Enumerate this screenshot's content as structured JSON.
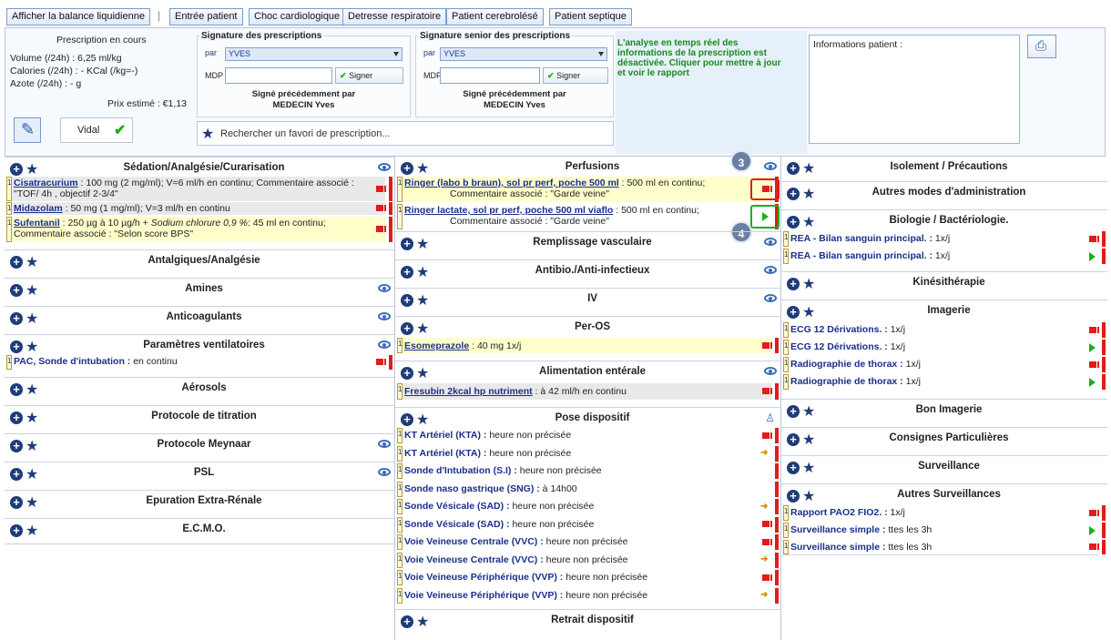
{
  "toolbar": {
    "balance": "Afficher la balance liquidienne",
    "entree": "Entrée patient",
    "choc": "Choc cardiologique",
    "detresse": "Detresse respiratoire",
    "cerebro": "Patient cerebrolésé",
    "septique": "Patient septique"
  },
  "prescription": {
    "title": "Prescription en cours",
    "volume": "Volume (/24h) : 6,25 ml/kg",
    "calories": "Calories (/24h) : - KCal (/kg=-)",
    "azote": "Azote (/24h) : - g",
    "prix": "Prix estimé : €1,13",
    "vidal": "Vidal"
  },
  "sig1": {
    "title": "Signature des prescriptions",
    "par": "par",
    "user": "YVES",
    "mdp": "MDP",
    "sign": "Signer",
    "prev": "Signé précédemment par",
    "prev_name": "MEDECIN Yves"
  },
  "sig2": {
    "title": "Signature senior des prescriptions",
    "par": "par",
    "user": "YVES",
    "mdp": "MDP",
    "sign": "Signer",
    "prev": "Signé précédemment par",
    "prev_name": "MEDECIN Yves"
  },
  "analysis": "L'analyse en temps réel des informations de la prescription est désactivée. Cliquer pour mettre à jour et voir le rapport",
  "patient_info": "Informations patient :",
  "favori_search": "Rechercher un favori de prescription...",
  "colors": {
    "accent": "#1f3c7a",
    "stop": "#e21b1b",
    "play": "#1bb01b",
    "analysis": "#1a8a1a"
  },
  "left": {
    "sedation": "Sédation/Analgésie/Curarisation",
    "cisa_med": "Cisatracurium",
    "cisa_text": " : 100 mg (2 mg/ml); V=6 ml/h  en continu; Commentaire associé : \"TOF/ 4h , objectif 2-3/4\"",
    "mida_med": "Midazolam",
    "mida_text": " : 50 mg (1 mg/ml); V=3 ml/h  en continu",
    "sufe_med": "Sufentanil",
    "sufe_text": " : 250 µg à 10 µg/h + ",
    "sufe_ital": "Sodium chlorure 0,9 %",
    "sufe_text2": ": 45 ml  en continu;        Commentaire associé : \"Selon score BPS\"",
    "antalgiques": "Antalgiques/Analgésie",
    "amines": "Amines",
    "anticoag": "Anticoagulants",
    "ventil": "Paramètres ventilatoires",
    "pac_med": "PAC, Sonde d'intubation :",
    "pac_text": "  en continu",
    "aerosols": "Aérosols",
    "titration": "Protocole de titration",
    "meynaar": "Protocole Meynaar",
    "psl": "PSL",
    "epuration": "Epuration Extra-Rénale",
    "ecmo": "E.C.M.O."
  },
  "mid": {
    "perfusions": "Perfusions",
    "ringer1_med": "Ringer (labo b braun), sol pr perf, poche 500 ml",
    "ringer1_text": " : 500 ml  en continu;",
    "ringer1_comment": "Commentaire associé : \"Garde veine\"",
    "ringer2_med": "Ringer lactate, sol pr perf, poche 500 ml viaflo",
    "ringer2_text": " : 500 ml  en continu;",
    "ringer2_comment": "Commentaire associé : \"Garde veine\"",
    "badge3": "3",
    "badge4": "4",
    "remplissage": "Remplissage vasculaire",
    "antibio": "Antibio./Anti-infectieux",
    "iv": "IV",
    "peros": "Per-OS",
    "esome_med": "Esomeprazole",
    "esome_text": " : 40 mg 1x/j",
    "enterale": "Alimentation entérale",
    "fresubin_med": "Fresubin 2kcal hp nutriment",
    "fresubin_text": " : à 42 ml/h  en continu",
    "pose": "Pose dispositif",
    "dispositifs": [
      {
        "name": "KT Artériel (KTA) :",
        "val": "  heure non précisée",
        "icon": "stop"
      },
      {
        "name": "KT Artériel (KTA) :",
        "val": "  heure non précisée",
        "icon": "arrow"
      },
      {
        "name": "Sonde d'Intubation (S.I) :",
        "val": "  heure non précisée",
        "icon": "none"
      },
      {
        "name": "Sonde naso gastrique (SNG) :",
        "val": "  à 14h00",
        "icon": "none"
      },
      {
        "name": "Sonde Vésicale (SAD) :",
        "val": "  heure non précisée",
        "icon": "arrow"
      },
      {
        "name": "Sonde Vésicale (SAD) :",
        "val": "  heure non précisée",
        "icon": "stop"
      },
      {
        "name": "Voie Veineuse Centrale (VVC) :",
        "val": "  heure non précisée",
        "icon": "stop"
      },
      {
        "name": "Voie Veineuse Centrale (VVC) :",
        "val": "  heure non précisée",
        "icon": "arrow"
      },
      {
        "name": "Voie Veineuse Périphérique (VVP) :",
        "val": "  heure non précisée",
        "icon": "stop"
      },
      {
        "name": "Voie Veineuse Périphérique (VVP) :",
        "val": "  heure non précisée",
        "icon": "arrow"
      }
    ],
    "retrait": "Retrait dispositif"
  },
  "right": {
    "isolement": "Isolement / Précautions",
    "autres_modes": "Autres modes d'administration",
    "biologie": "Biologie / Bactériologie.",
    "rea1_name": "REA  - Bilan sanguin principal. :",
    "rea1_val": "  1x/j",
    "rea2_name": "REA  - Bilan sanguin principal. :",
    "rea2_val": "  1x/j",
    "kine": "Kinésithérapie",
    "imagerie": "Imagerie",
    "ecg1_name": "ECG 12 Dérivations. :",
    "ecg1_val": "  1x/j",
    "ecg2_name": "ECG 12 Dérivations. :",
    "ecg2_val": "  1x/j",
    "radio1_name": "Radiographie de thorax :",
    "radio1_val": "  1x/j",
    "radio2_name": "Radiographie de thorax :",
    "radio2_val": "  1x/j",
    "bon_imagerie": "Bon Imagerie",
    "consignes": "Consignes Particulières",
    "surveillance": "Surveillance",
    "autres_surv": "Autres Surveillances",
    "pao2_name": "Rapport PAO2 FIO2. :",
    "pao2_val": "  1x/j",
    "surv1_name": "Surveillance simple :",
    "surv1_val": "  ttes les 3h",
    "surv2_name": "Surveillance simple :",
    "surv2_val": "  ttes les 3h"
  }
}
